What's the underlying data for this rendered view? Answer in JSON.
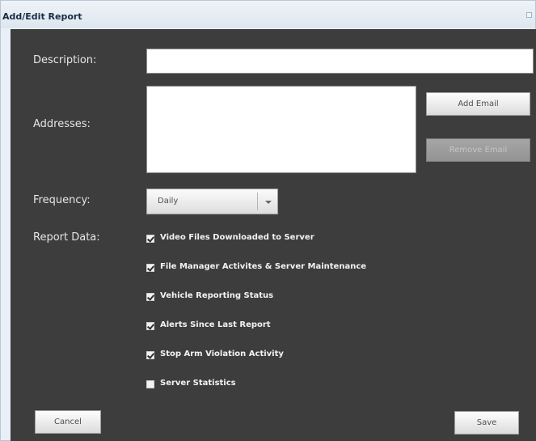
{
  "window": {
    "title": "Add/Edit Report"
  },
  "form": {
    "description_label": "Description:",
    "description_value": "",
    "addresses_label": "Addresses:",
    "addresses_value": "",
    "add_email_label": "Add Email",
    "remove_email_label": "Remove Email",
    "frequency_label": "Frequency:",
    "frequency_value": "Daily",
    "report_data_label": "Report Data:",
    "report_items": [
      {
        "label": "Video Files Downloaded to Server",
        "checked": true
      },
      {
        "label": "File Manager Activites & Server Maintenance",
        "checked": true
      },
      {
        "label": "Vehicle Reporting Status",
        "checked": true
      },
      {
        "label": "Alerts Since Last Report",
        "checked": true
      },
      {
        "label": "Stop Arm Violation Activity",
        "checked": true
      },
      {
        "label": "Server Statistics",
        "checked": false
      }
    ],
    "cancel_label": "Cancel",
    "save_label": "Save"
  },
  "colors": {
    "panel": "#3d3d3d",
    "title_text": "#1a2b48"
  }
}
